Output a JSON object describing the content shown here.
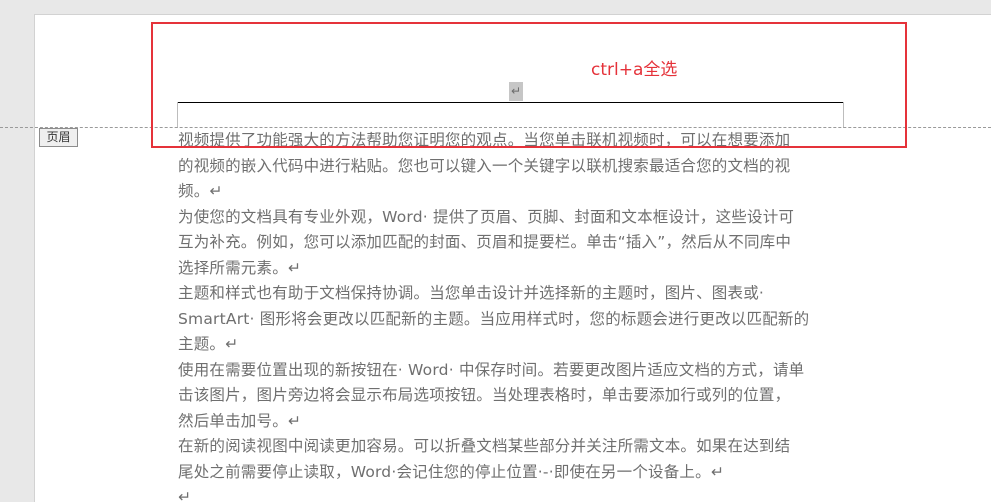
{
  "document": {
    "header_paragraph_mark": "↵",
    "header_tag_label": "页眉",
    "annotation": {
      "label": "ctrl+a全选",
      "color": "#e5323a"
    },
    "paragraph_mark": "↵",
    "body_lines": [
      "视频提供了功能强大的方法帮助您证明您的观点。当您单击联机视频时，可以在想要添加",
      "的视频的嵌入代码中进行粘贴。您也可以键入一个关键字以联机搜索最适合您的文档的视",
      "频。↵",
      "为使您的文档具有专业外观，Word· 提供了页眉、页脚、封面和文本框设计，这些设计可",
      "互为补充。例如，您可以添加匹配的封面、页眉和提要栏。单击“插入”，然后从不同库中",
      "选择所需元素。↵",
      "主题和样式也有助于文档保持协调。当您单击设计并选择新的主题时，图片、图表或·",
      "SmartArt· 图形将会更改以匹配新的主题。当应用样式时，您的标题会进行更改以匹配新的",
      "主题。↵",
      "使用在需要位置出现的新按钮在· Word· 中保存时间。若要更改图片适应文档的方式，请单",
      "击该图片，图片旁边将会显示布局选项按钮。当处理表格时，单击要添加行或列的位置，",
      "然后单击加号。↵",
      "在新的阅读视图中阅读更加容易。可以折叠文档某些部分并关注所需文本。如果在达到结",
      "尾处之前需要停止读取，Word·会记住您的停止位置·-·即使在另一个设备上。↵",
      "↵"
    ]
  }
}
